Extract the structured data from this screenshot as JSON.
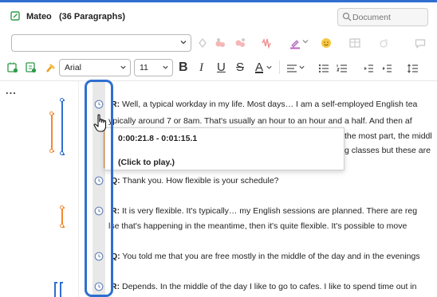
{
  "header": {
    "title": "Mateo   (36 Paragraphs)",
    "search_placeholder": "Document"
  },
  "toolbar": {
    "style_value": "",
    "font_name": "Arial",
    "font_size": "11",
    "bold": "B",
    "italic": "I",
    "underline": "U",
    "strike": "S",
    "font_color": "A"
  },
  "left_panel": {
    "more": "..."
  },
  "tooltip": {
    "timecode": "0:00:21.8 - 0:01:15.1",
    "hint": "(Click to play.)"
  },
  "transcript": {
    "p1": {
      "speaker": "R:",
      "text": " Well, a typical workday in my life. Most days… I am a self-employed English tea"
    },
    "p1_line2": "ypically around 7 or 8am. That's usually an hour to an hour and a half. And then af",
    "p1_line3": "the most part, the middl",
    "p1_line4": "g classes but these are",
    "p2": {
      "speaker": "Q:",
      "text": " Thank you. How flexible is your schedule?"
    },
    "p3": {
      "speaker": "R:",
      "text": " It is very flexible. It's typically… my English sessions are planned. There are reg"
    },
    "p3_line2": "lse that's happening in the meantime, then it's quite flexible. It's possible to move",
    "p4": {
      "speaker": "Q:",
      "text": " You told me that you are free mostly in the middle of the day and in the evenings"
    },
    "p5": {
      "speaker": "R:",
      "text": " Depends. In the middle of the day I like to go to cafes. I like to spend time out in"
    }
  },
  "colors": {
    "accent_blue": "#2f6fd0",
    "code_orange": "#f28a2e",
    "code_blue": "#2f6fd0"
  }
}
